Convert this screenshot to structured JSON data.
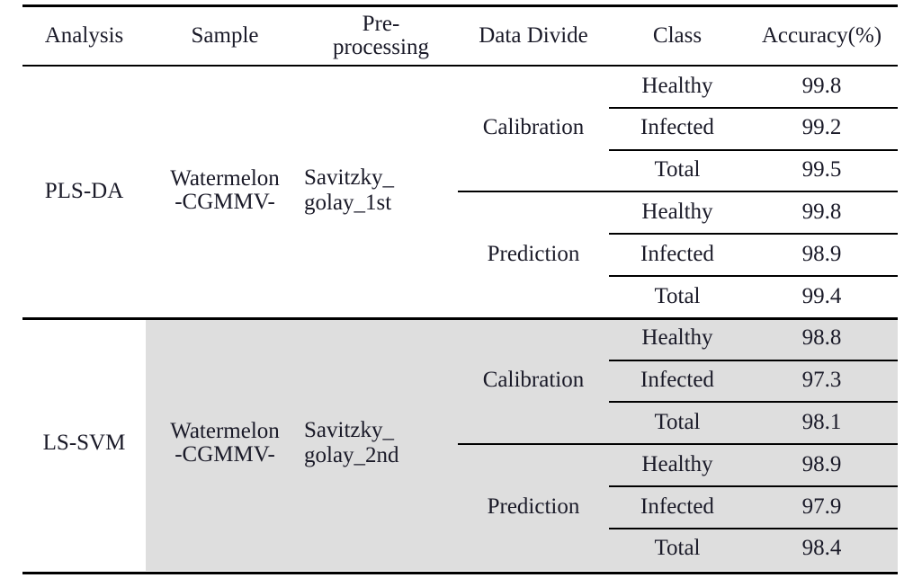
{
  "table": {
    "columns": [
      {
        "key": "analysis",
        "label": "Analysis"
      },
      {
        "key": "sample",
        "label": "Sample"
      },
      {
        "key": "preprocessing",
        "label": "Pre-\nprocessing"
      },
      {
        "key": "data_divide",
        "label": "Data  Divide"
      },
      {
        "key": "class",
        "label": "Class"
      },
      {
        "key": "accuracy",
        "label": "Accuracy(%)"
      }
    ],
    "sections": [
      {
        "analysis": "PLS-DA",
        "sample": "Watermelon\n-CGMMV-",
        "preprocessing": "Savitzky_\ngolay_1st",
        "shaded": false,
        "groups": [
          {
            "data_divide": "Calibration",
            "rows": [
              {
                "class": "Healthy",
                "accuracy": "99.8"
              },
              {
                "class": "Infected",
                "accuracy": "99.2"
              },
              {
                "class": "Total",
                "accuracy": "99.5"
              }
            ]
          },
          {
            "data_divide": "Prediction",
            "rows": [
              {
                "class": "Healthy",
                "accuracy": "99.8"
              },
              {
                "class": "Infected",
                "accuracy": "98.9"
              },
              {
                "class": "Total",
                "accuracy": "99.4"
              }
            ]
          }
        ]
      },
      {
        "analysis": "LS-SVM",
        "sample": "Watermelon\n-CGMMV-",
        "preprocessing": "Savitzky_\ngolay_2nd",
        "shaded": true,
        "groups": [
          {
            "data_divide": "Calibration",
            "rows": [
              {
                "class": "Healthy",
                "accuracy": "98.8"
              },
              {
                "class": "Infected",
                "accuracy": "97.3"
              },
              {
                "class": "Total",
                "accuracy": "98.1"
              }
            ]
          },
          {
            "data_divide": "Prediction",
            "rows": [
              {
                "class": "Healthy",
                "accuracy": "98.9"
              },
              {
                "class": "Infected",
                "accuracy": "97.9"
              },
              {
                "class": "Total",
                "accuracy": "98.4"
              }
            ]
          }
        ]
      }
    ],
    "colors": {
      "rule": "#000000",
      "shade": "#dedede",
      "text": "#1a1a28",
      "background": "#ffffff"
    }
  }
}
